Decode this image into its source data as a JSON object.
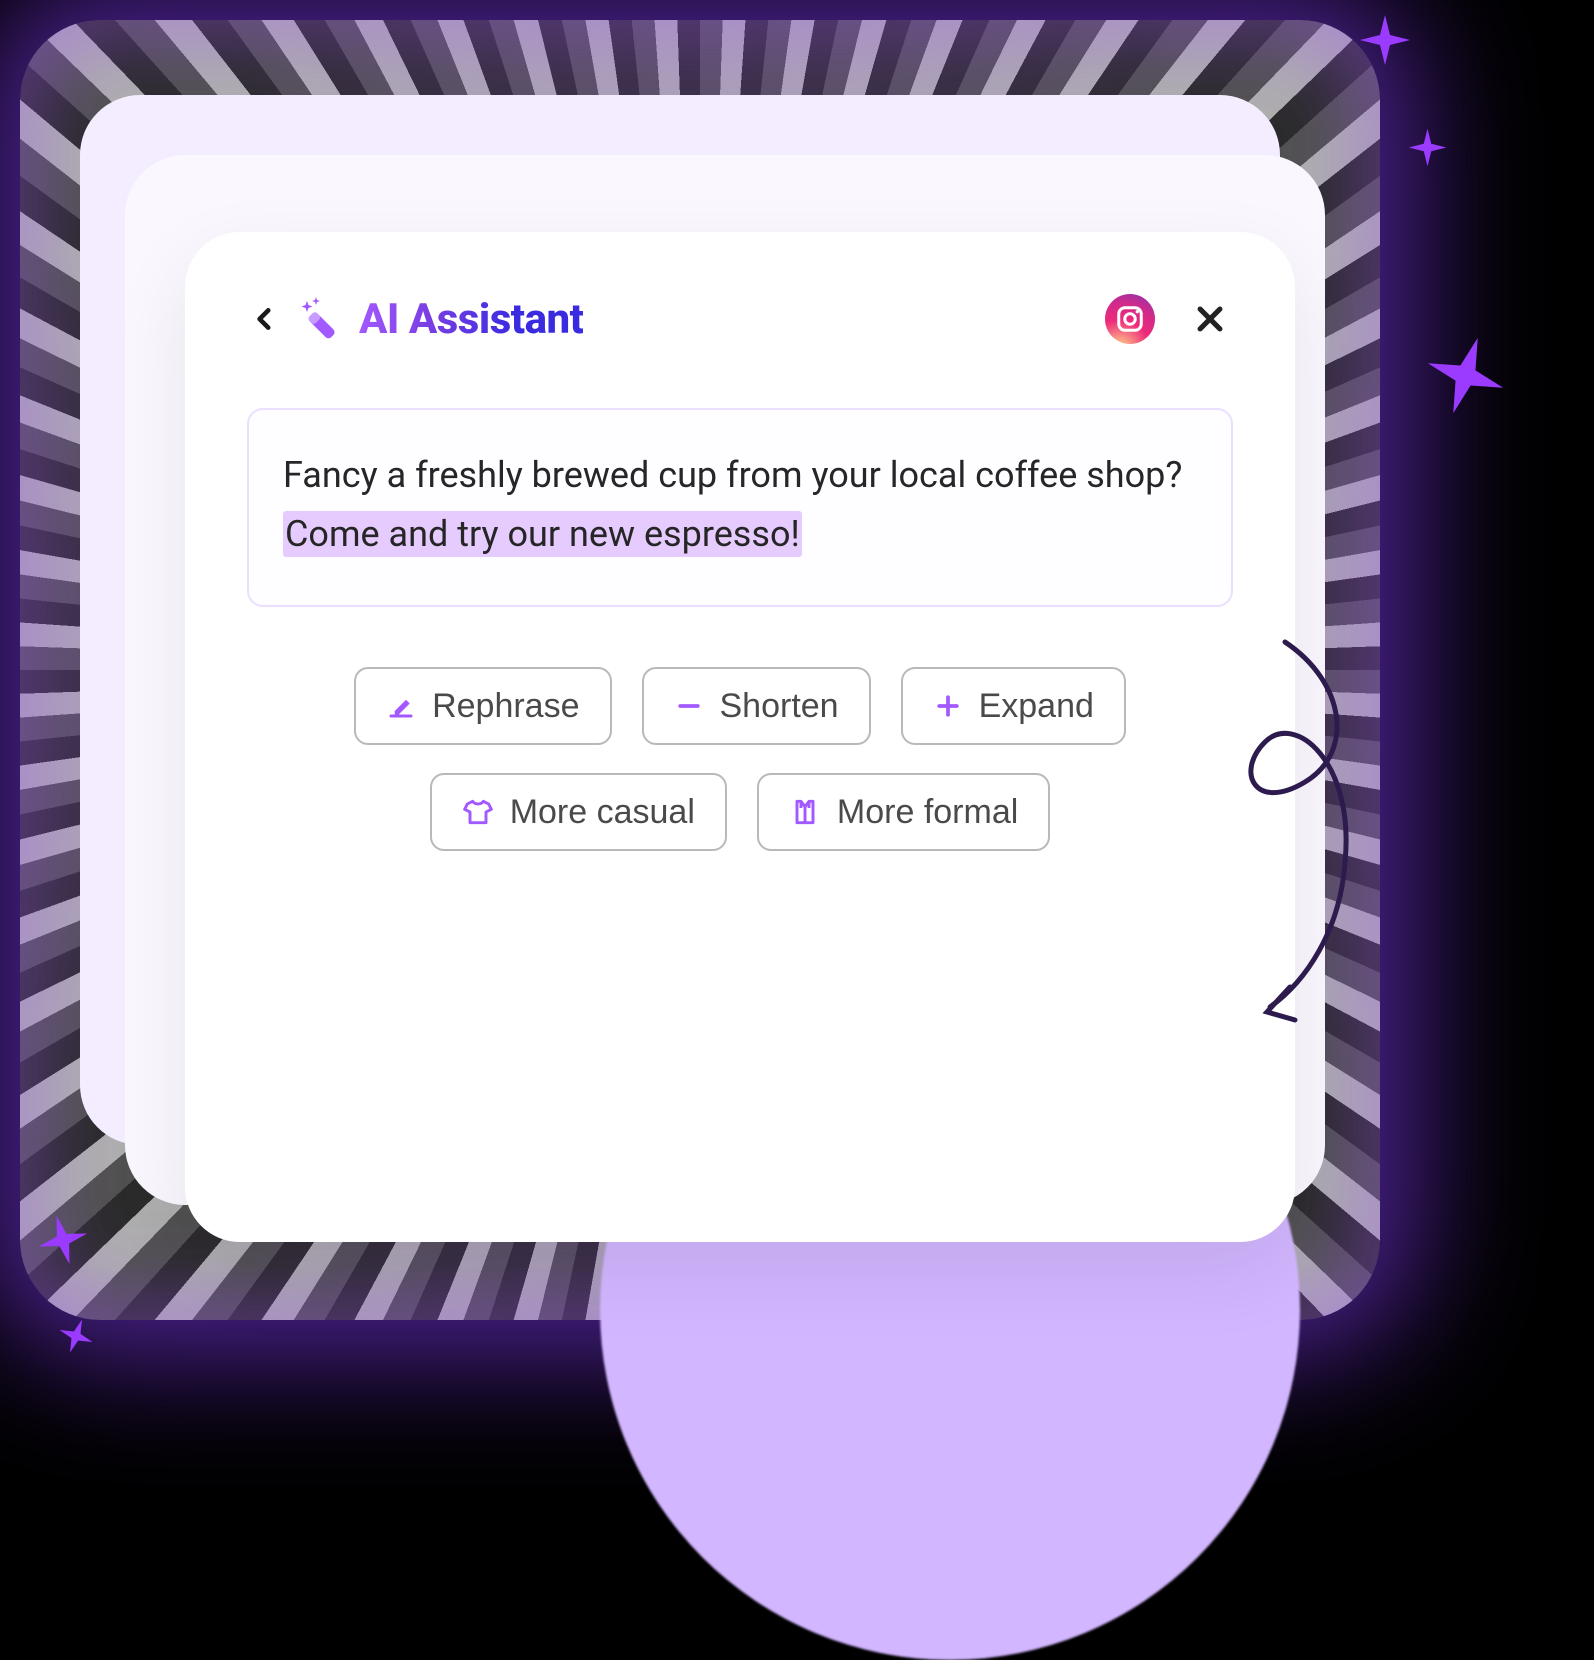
{
  "header": {
    "title": "AI Assistant"
  },
  "content": {
    "plain": "Fancy a freshly brewed cup from your local coffee shop? ",
    "highlighted": "Come and try our new espresso!"
  },
  "actions": {
    "rephrase": "Rephrase",
    "shorten": "Shorten",
    "expand": "Expand",
    "casual": "More casual",
    "formal": "More formal"
  }
}
